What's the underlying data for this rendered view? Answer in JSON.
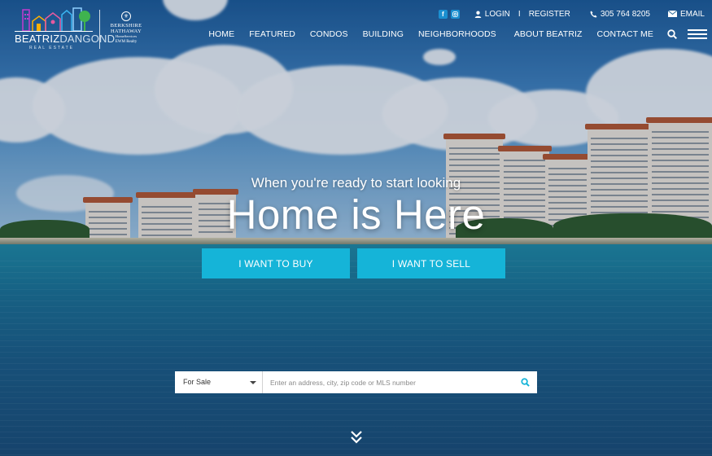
{
  "brand": {
    "logo_part1": "BEATRIZ",
    "logo_part2": "DANGOND",
    "logo_sub": "REAL ESTATE",
    "partner_line1": "BERKSHIRE",
    "partner_line2": "HATHAWAY",
    "partner_line3": "HomeServices",
    "partner_line4": "EWM Realty"
  },
  "topbar": {
    "login": "LOGIN",
    "separator": "I",
    "register": "REGISTER",
    "phone": "305 764 8205",
    "email": "EMAIL"
  },
  "nav": {
    "items": [
      "HOME",
      "FEATURED",
      "CONDOS",
      "BUILDING",
      "NEIGHBORHOODS",
      "ABOUT BEATRIZ",
      "CONTACT ME"
    ]
  },
  "hero": {
    "subtitle": "When you're ready to start looking",
    "title": "Home is Here",
    "buy_label": "I WANT TO BUY",
    "sell_label": "I WANT TO SELL"
  },
  "search": {
    "type_selected": "For Sale",
    "placeholder": "Enter an address, city, zip code or MLS number"
  },
  "colors": {
    "accent": "#15b4d8",
    "facebook": "#1b8fd0",
    "instagram": "#1b8fd0"
  },
  "icons": [
    "facebook-icon",
    "instagram-icon",
    "user-icon",
    "phone-icon",
    "envelope-icon",
    "search-icon",
    "hamburger-icon",
    "chevron-double-down-icon"
  ]
}
